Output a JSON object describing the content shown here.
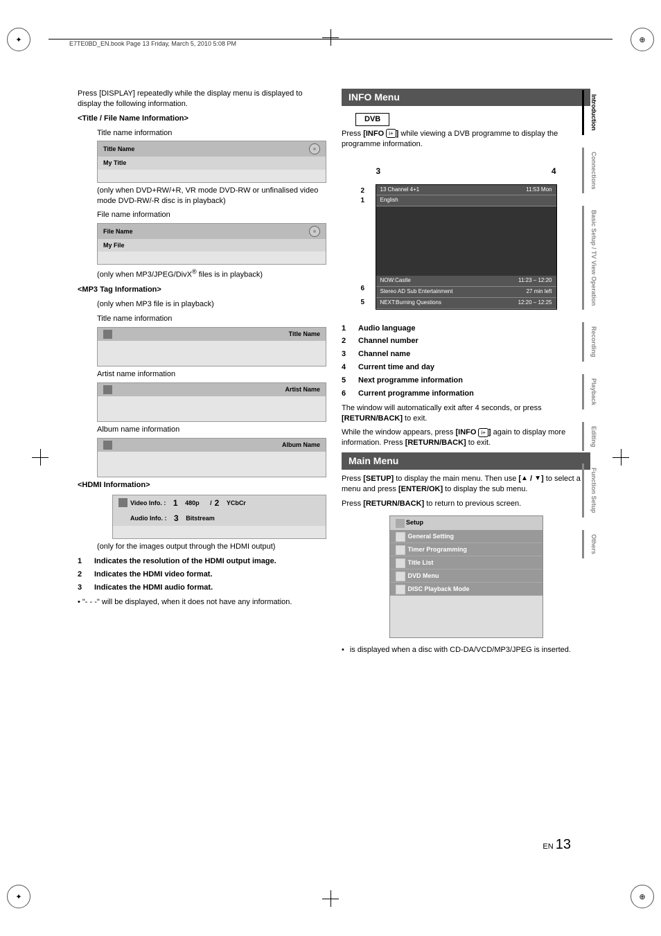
{
  "header": "E7TE0BD_EN.book  Page 13  Friday, March 5, 2010  5:08 PM",
  "left": {
    "intro": "Press [DISPLAY] repeatedly while the display menu is displayed to display the following information.",
    "titleFileHeading": "<Title / File Name Information>",
    "titleNameLabel": "Title name information",
    "box1": {
      "hdr": "Title Name",
      "row": "My Title"
    },
    "note1": "(only when DVD+RW/+R, VR mode DVD-RW or unfinalised video mode DVD-RW/-R disc is in playback)",
    "fileNameLabel": "File name information",
    "box2": {
      "hdr": "File Name",
      "row": "My File"
    },
    "note2_a": "(only when MP3/JPEG/DivX",
    "note2_b": " files is in playback)",
    "mp3Heading": "<MP3 Tag Information>",
    "mp3Note": "(only when MP3 file is in playback)",
    "titleName2Label": "Title name information",
    "box3": {
      "hdr": "Title Name"
    },
    "artistLabel": "Artist name information",
    "box4": {
      "hdr": "Artist Name"
    },
    "albumLabel": "Album name information",
    "box5": {
      "hdr": "Album Name"
    },
    "hdmiHeading": "<HDMI Information>",
    "hdmiBox": {
      "videoLabel": "Video Info.  :",
      "videoN1": "1",
      "videoVal": "480p",
      "slash": "/",
      "videoN2": "2",
      "videoFmt": "YCbCr",
      "audioLabel": "Audio Info.  :",
      "audioN": "3",
      "audioVal": "Bitstream"
    },
    "hdmiNote": "(only for the images output through the HDMI output)",
    "hdmiList": [
      {
        "n": "1",
        "t": "Indicates the resolution of the HDMI output image."
      },
      {
        "n": "2",
        "t": "Indicates the HDMI video format."
      },
      {
        "n": "3",
        "t": "Indicates the HDMI audio format."
      }
    ],
    "hdmiFoot": "• \"- - -\" will be displayed, when it does not have any information."
  },
  "right": {
    "infoMenu": "INFO Menu",
    "dvb": "DVB",
    "infoIntro_a": "Press ",
    "infoIntro_b": "[INFO ",
    "infoIntro_c": "]",
    "infoIntro_d": " while viewing a DVB programme to display the programme information.",
    "dvbTopNums": {
      "left": "3",
      "right": "4"
    },
    "dvbDiag": {
      "line1l": "13 Channel 4+1",
      "line1r": "11:53 Mon",
      "line2l": "English",
      "now": "NOW:Castle",
      "nowTime": "11:23 – 12:20",
      "mid": "Stereo    AD    Sub  Entertainment",
      "midTime": "27 min left",
      "next": "NEXT:Burning Questions",
      "nextTime": "12:20 – 12:25",
      "labels": {
        "l1": "1",
        "l2": "2",
        "l3": "3",
        "l4": "4",
        "l5": "5",
        "l6": "6"
      }
    },
    "list": [
      {
        "n": "1",
        "t": "Audio language"
      },
      {
        "n": "2",
        "t": "Channel number"
      },
      {
        "n": "3",
        "t": "Channel name"
      },
      {
        "n": "4",
        "t": "Current time and day"
      },
      {
        "n": "5",
        "t": "Next programme information"
      },
      {
        "n": "6",
        "t": "Current programme information"
      }
    ],
    "autoExit_a": "The window will automatically exit after 4 seconds, or press ",
    "autoExit_b": "[RETURN/BACK]",
    "autoExit_c": " to exit.",
    "whileWindow_a": "While the window appears, press ",
    "whileWindow_b": "[INFO ",
    "whileWindow_c": "]",
    "whileWindow_d": " again to display more information. Press ",
    "whileWindow_e": "[RETURN/BACK]",
    "whileWindow_f": " to exit.",
    "mainMenu": "Main Menu",
    "mainIntro_a": "Press ",
    "mainIntro_b": "[SETUP]",
    "mainIntro_c": " to display the main menu. Then use ",
    "mainIntro_d": "[",
    "mainIntro_e": " / ",
    "mainIntro_f": "]",
    "mainIntro_g": " to select a menu and press ",
    "mainIntro_h": "[ENTER/OK]",
    "mainIntro_i": " to display the sub menu.",
    "mainReturn_a": "Press ",
    "mainReturn_b": "[RETURN/BACK]",
    "mainReturn_c": " to return to previous screen.",
    "setup": {
      "title": "Setup",
      "items": [
        "General Setting",
        "Timer Programming",
        "Title List",
        "DVD Menu",
        "DISC Playback Mode"
      ]
    },
    "footBullet": "is displayed when a disc with CD-DA/VCD/MP3/JPEG is inserted."
  },
  "tabs": [
    "Introduction",
    "Connections",
    "Basic Setup /\nTV View Operation",
    "Recording",
    "Playback",
    "Editing",
    "Function Setup",
    "Others"
  ],
  "pageNum": {
    "en": "EN",
    "num": "13"
  }
}
